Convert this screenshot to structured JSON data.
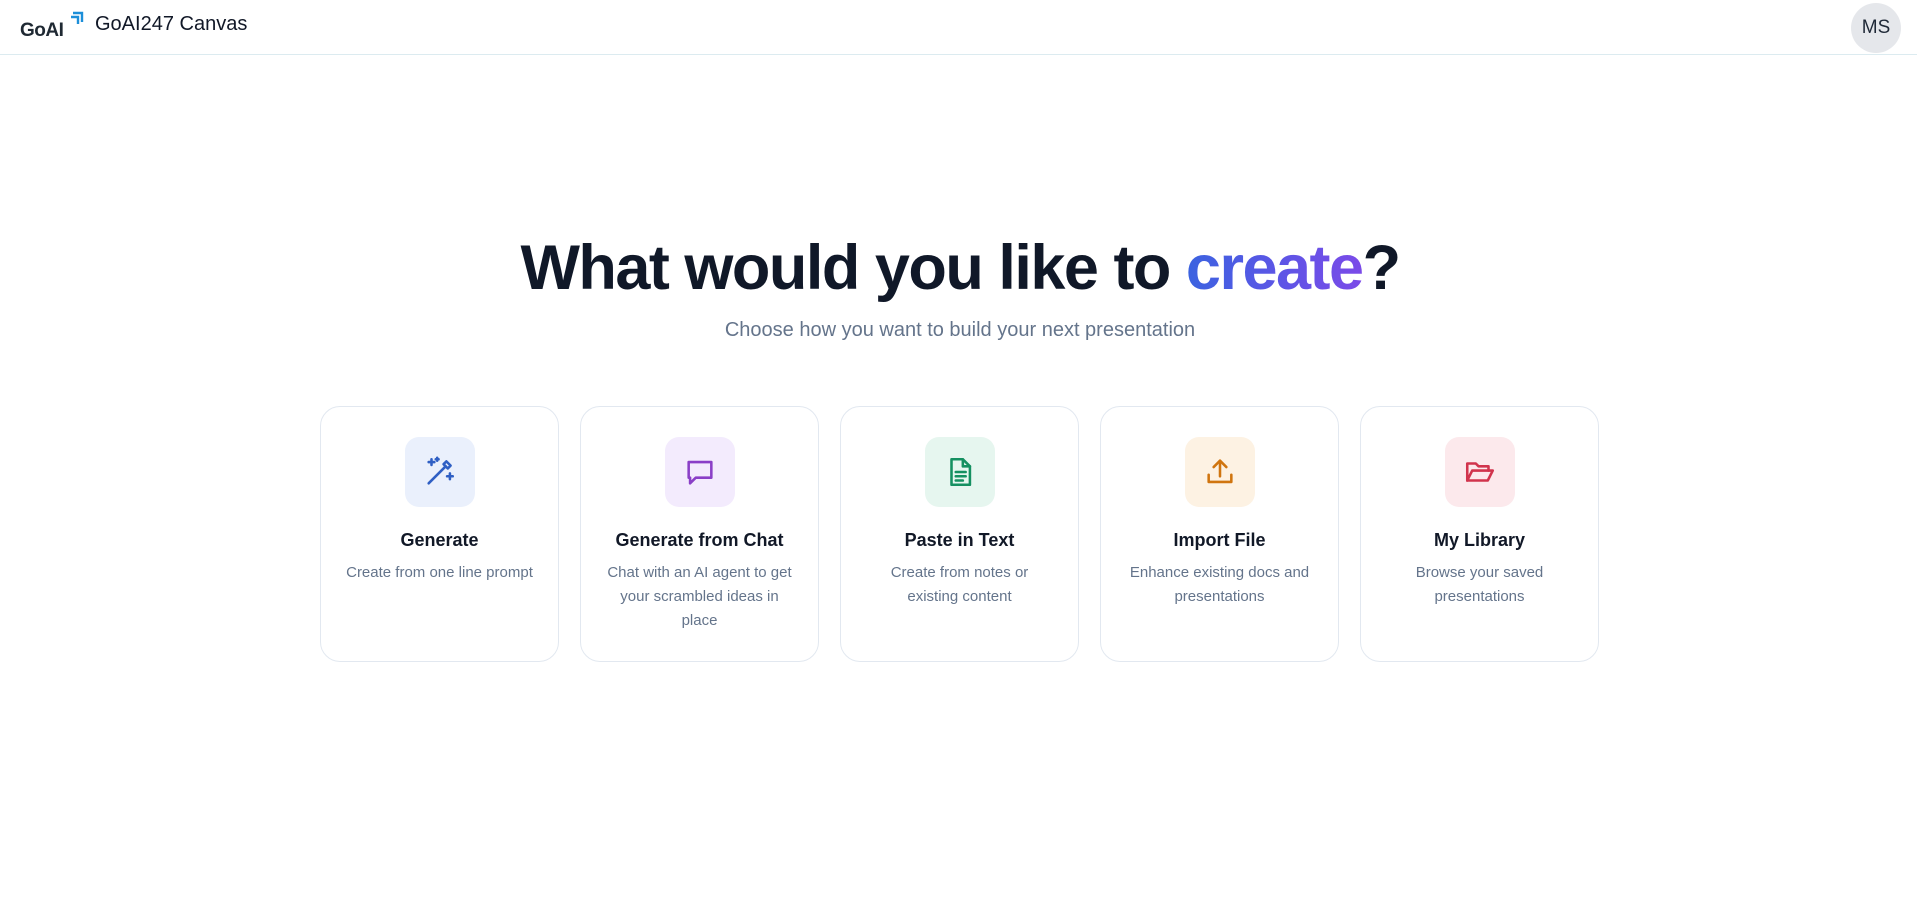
{
  "header": {
    "logo_text": "GoAI",
    "app_title": "GoAI247 Canvas",
    "avatar_initials": "MS"
  },
  "hero": {
    "title_prefix": "What would you like to ",
    "title_accent": "create",
    "title_suffix": "?",
    "subtitle": "Choose how you want to build your next presentation"
  },
  "cards": [
    {
      "title": "Generate",
      "description": "Create from one line prompt",
      "icon": "magic-wand-icon",
      "icon_color": "#2f5fc4",
      "icon_bg": "#eaf0fc"
    },
    {
      "title": "Generate from Chat",
      "description": "Chat with an AI agent to get your scrambled ideas in place",
      "icon": "chat-bubble-icon",
      "icon_color": "#8a3fc7",
      "icon_bg": "#f3ebfd"
    },
    {
      "title": "Paste in Text",
      "description": "Create from notes or existing content",
      "icon": "document-icon",
      "icon_color": "#159061",
      "icon_bg": "#e6f6ef"
    },
    {
      "title": "Import File",
      "description": "Enhance existing docs and presentations",
      "icon": "upload-icon",
      "icon_color": "#d0750f",
      "icon_bg": "#fdf2e3"
    },
    {
      "title": "My Library",
      "description": "Browse your saved presentations",
      "icon": "folder-open-icon",
      "icon_color": "#d1344d",
      "icon_bg": "#fce9ec"
    }
  ],
  "colors": {
    "accent_start": "#3b63e0",
    "accent_end": "#7b4ae8",
    "header_border": "#dcebf0",
    "logo_mark": "#1c8fd9"
  }
}
